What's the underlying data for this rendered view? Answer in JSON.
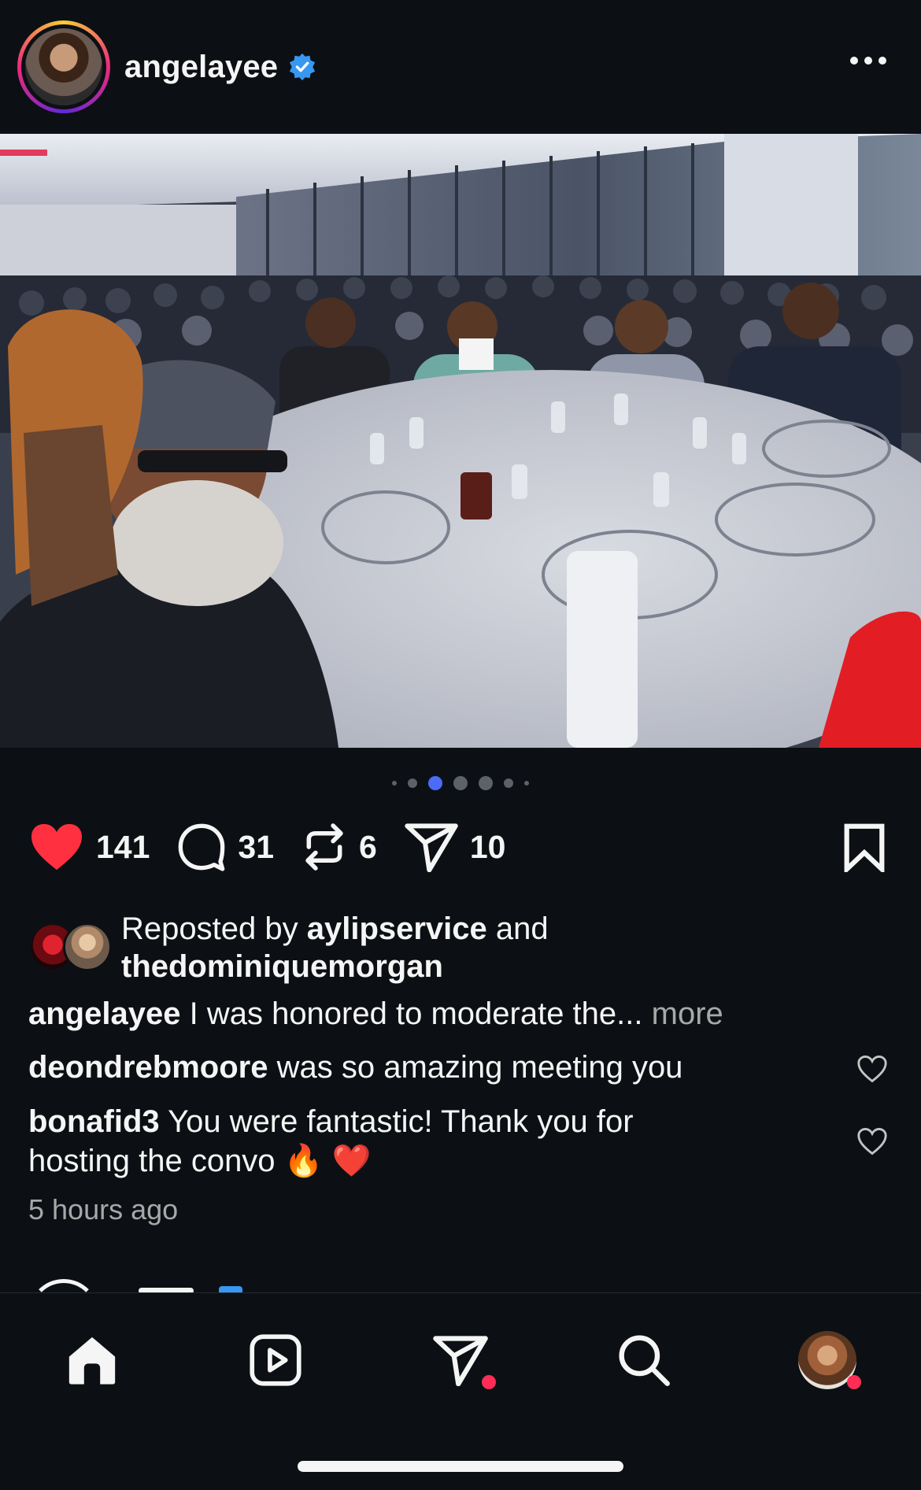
{
  "post": {
    "username": "angelayee",
    "verified": true,
    "menu_icon": "more-horizontal-icon",
    "carousel": {
      "total": 7,
      "active_index": 2
    },
    "likes": "141",
    "comments": "31",
    "reposts": "6",
    "shares": "10",
    "liked": true,
    "repost_line": {
      "prefix": "Reposted by",
      "user1": "aylipservice",
      "joiner": "and",
      "user2": "thedominiquemorgan"
    },
    "caption": {
      "username": "angelayee",
      "text": "I was honored to moderate the...",
      "more": "more"
    },
    "comments_preview": [
      {
        "username": "deondrebmoore",
        "text": "was so amazing meeting you"
      },
      {
        "username": "bonafid3",
        "text": "You were fantastic! Thank you for",
        "text2": "hosting the convo 🔥 ❤️"
      }
    ],
    "time_ago": "5 hours ago"
  },
  "nav": {
    "items": [
      "home-icon",
      "reels-icon",
      "messages-icon",
      "search-icon",
      "profile-avatar"
    ],
    "notification_color": "#ff2d55"
  },
  "colors": {
    "background": "#0c1014",
    "like_red": "#ff3040",
    "verified_blue": "#3897f0",
    "active_dot": "#4a6cf7"
  }
}
